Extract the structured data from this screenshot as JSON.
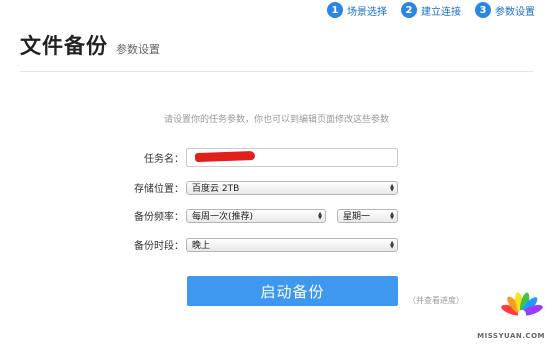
{
  "steps": [
    {
      "num": "1",
      "label": "场景选择"
    },
    {
      "num": "2",
      "label": "建立连接"
    },
    {
      "num": "3",
      "label": "参数设置"
    }
  ],
  "header": {
    "title": "文件备份",
    "subtitle": "参数设置"
  },
  "hint": "请设置你的任务参数，你也可以到编辑页面修改这些参数",
  "form": {
    "task_name_label": "任务名：",
    "storage_label": "存储位置：",
    "storage_value": "百度云 2TB",
    "frequency_label": "备份频率：",
    "frequency_value": "每周一次(推荐)",
    "weekday_value": "星期一",
    "time_label": "备份时段：",
    "time_value": "晚上"
  },
  "start_button": "启动备份",
  "view_progress": "（并查看进度）",
  "watermark": "MISSYUAN.COM",
  "colors": {
    "accent": "#3e98f0",
    "step": "#2b85e4"
  }
}
